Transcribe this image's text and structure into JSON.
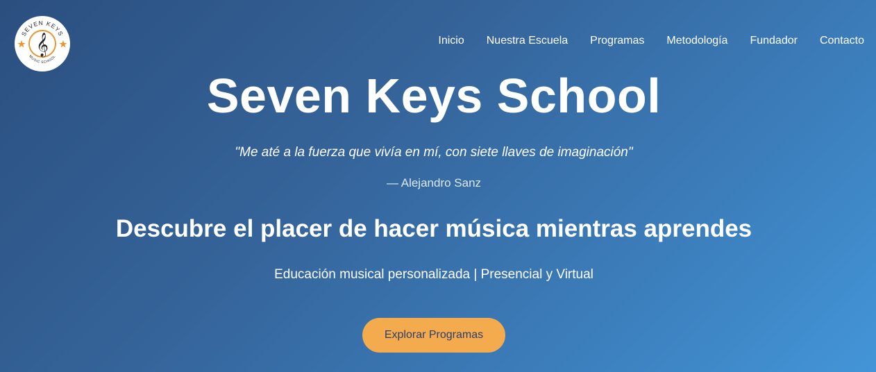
{
  "logo": {
    "top_text": "SEVEN KEYS",
    "bottom_text": "MUSIC SCHOOL",
    "accent": "#e8962f"
  },
  "nav": {
    "items": [
      "Inicio",
      "Nuestra Escuela",
      "Programas",
      "Metodología",
      "Fundador",
      "Contacto"
    ]
  },
  "hero": {
    "title": "Seven Keys School",
    "quote": "\"Me até a la fuerza que vivía en mí, con siete llaves de imaginación\"",
    "author": "— Alejandro Sanz",
    "tagline": "Descubre el placer de hacer música mientras aprendes",
    "subtitle": "Educación musical personalizada | Presencial y Virtual",
    "cta_label": "Explorar Programas"
  },
  "colors": {
    "cta_background": "#f4ab4e",
    "cta_text": "#2c3e6b",
    "gradient_start": "#2b4f7f",
    "gradient_end": "#4395d8"
  }
}
